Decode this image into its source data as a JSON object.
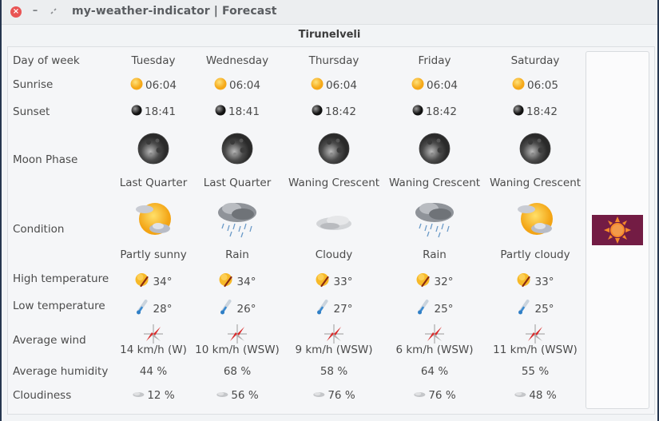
{
  "window": {
    "title": "my-weather-indicator | Forecast",
    "close_icon": "close-icon",
    "minimize_icon": "minimize-icon",
    "maximize_icon": "maximize-icon"
  },
  "location": "Tirunelveli",
  "row_labels": {
    "day": "Day of week",
    "sunrise": "Sunrise",
    "sunset": "Sunset",
    "moon": "Moon Phase",
    "condition": "Condition",
    "high": "High temperature",
    "low": "Low temperature",
    "wind": "Average wind",
    "humidity": "Average humidity",
    "cloudiness": "Cloudiness"
  },
  "days": [
    {
      "day": "Tuesday",
      "sunrise": "06:04",
      "sunset": "18:41",
      "moon_phase": "Last Quarter",
      "condition": "Partly sunny",
      "condition_icon": "partly-sunny-icon",
      "high": "34°",
      "low": "28°",
      "wind": "14 km/h (W)",
      "humidity": "44 %",
      "cloudiness": "12 %"
    },
    {
      "day": "Wednesday",
      "sunrise": "06:04",
      "sunset": "18:41",
      "moon_phase": "Last Quarter",
      "condition": "Rain",
      "condition_icon": "rain-icon",
      "high": "34°",
      "low": "26°",
      "wind": "10 km/h (WSW)",
      "humidity": "68 %",
      "cloudiness": "56 %"
    },
    {
      "day": "Thursday",
      "sunrise": "06:04",
      "sunset": "18:42",
      "moon_phase": "Waning Crescent",
      "condition": "Cloudy",
      "condition_icon": "cloudy-icon",
      "high": "33°",
      "low": "27°",
      "wind": "9 km/h (WSW)",
      "humidity": "58 %",
      "cloudiness": "76 %"
    },
    {
      "day": "Friday",
      "sunrise": "06:04",
      "sunset": "18:42",
      "moon_phase": "Waning Crescent",
      "condition": "Rain",
      "condition_icon": "rain-icon",
      "high": "32°",
      "low": "25°",
      "wind": "6 km/h (WSW)",
      "humidity": "64 %",
      "cloudiness": "76 %"
    },
    {
      "day": "Saturday",
      "sunrise": "06:05",
      "sunset": "18:42",
      "moon_phase": "Waning Crescent",
      "condition": "Partly cloudy",
      "condition_icon": "partly-cloudy-icon",
      "high": "33°",
      "low": "25°",
      "wind": "11 km/h (WSW)",
      "humidity": "55 %",
      "cloudiness": "48 %"
    }
  ],
  "provider_logo": "weather-provider-logo",
  "colors": {
    "logo_bg": "#731c44",
    "logo_sun": "#f7892a",
    "close_button": "#e95454"
  }
}
